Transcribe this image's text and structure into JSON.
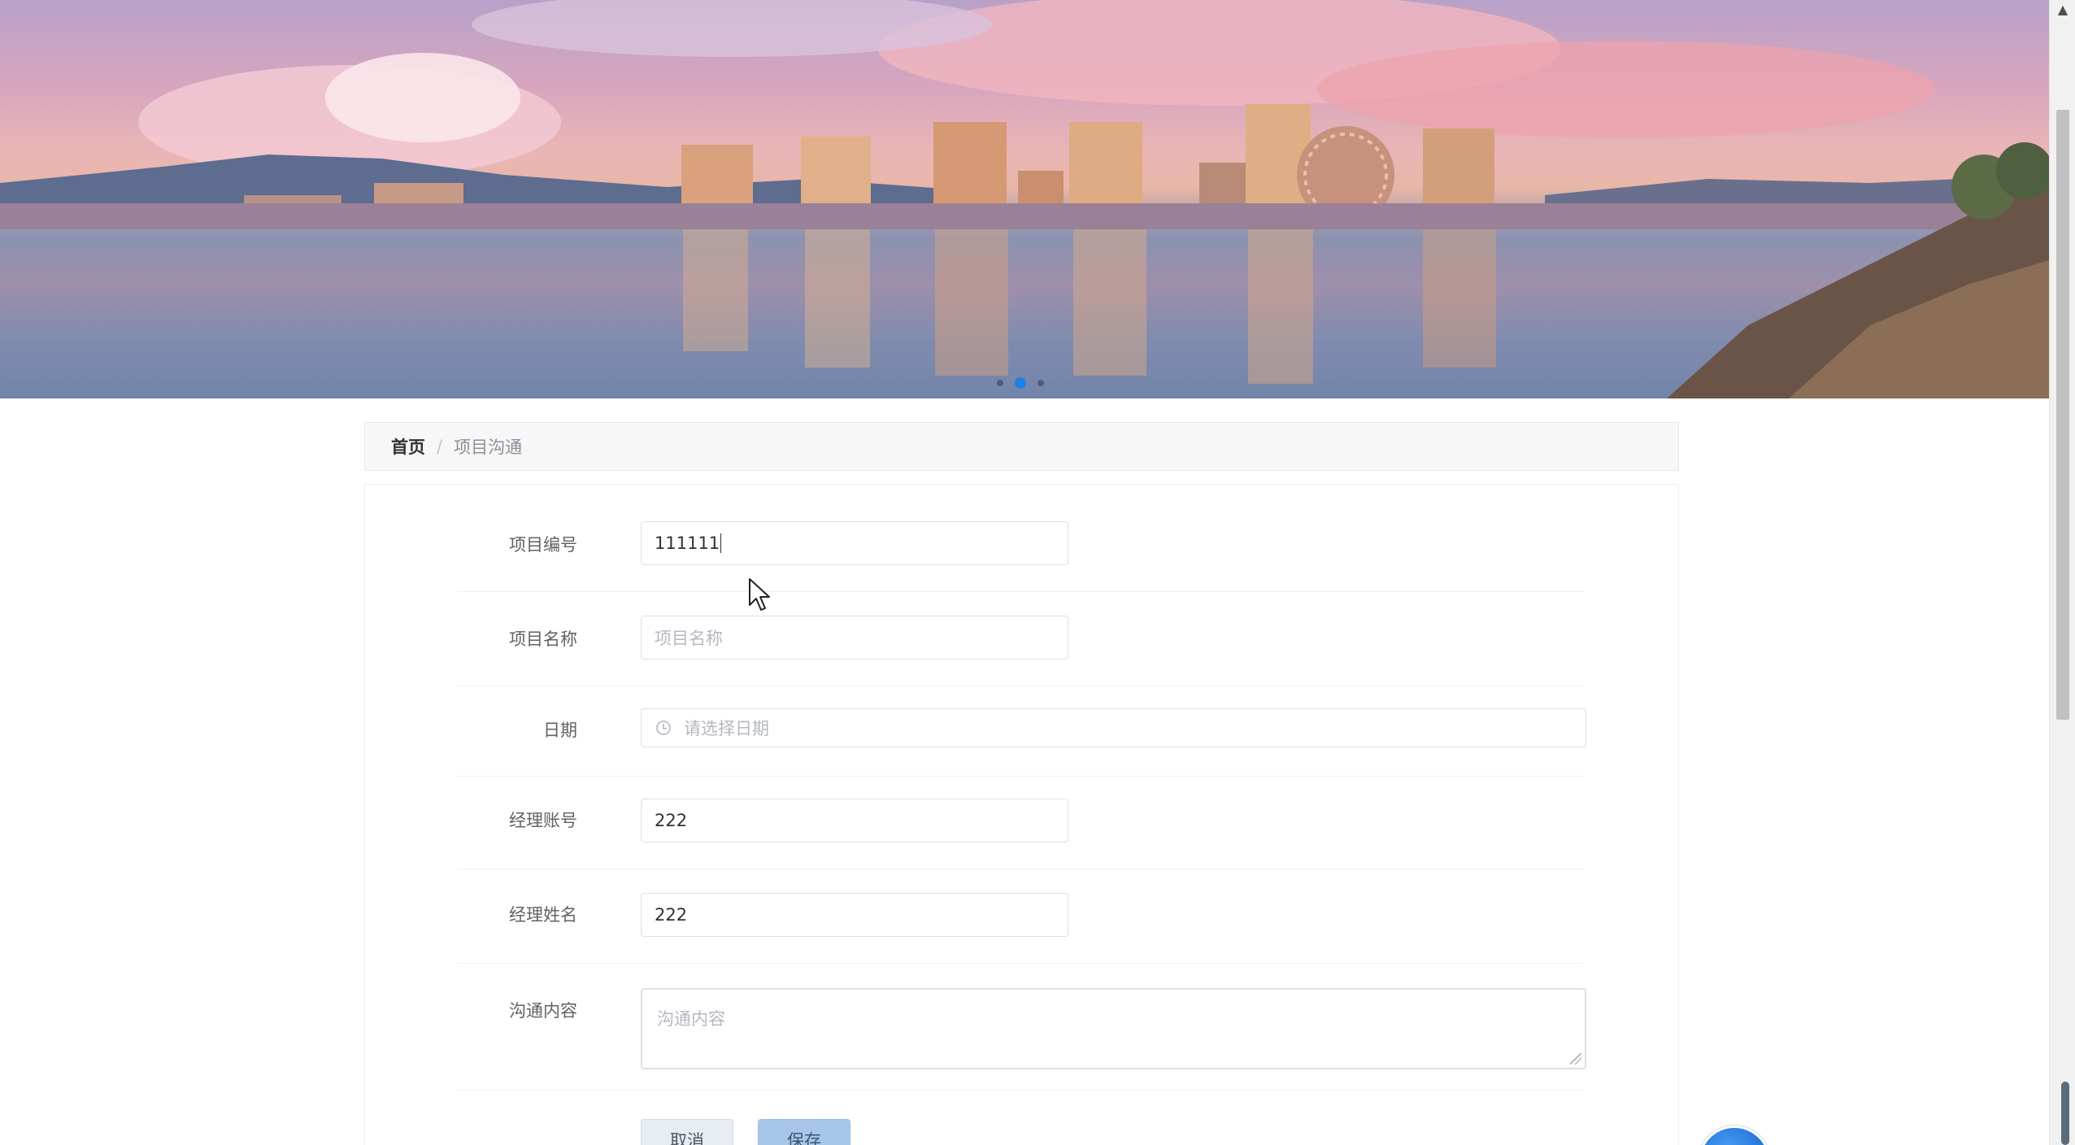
{
  "breadcrumb": {
    "home": "首页",
    "separator": "/",
    "current": "项目沟通"
  },
  "form": {
    "project_number": {
      "label": "项目编号",
      "value": "111111"
    },
    "project_name": {
      "label": "项目名称",
      "placeholder": "项目名称"
    },
    "date": {
      "label": "日期",
      "placeholder": "请选择日期",
      "icon": "clock-icon"
    },
    "manager_account": {
      "label": "经理账号",
      "value": "222"
    },
    "manager_name": {
      "label": "经理姓名",
      "value": "222"
    },
    "content": {
      "label": "沟通内容",
      "placeholder": "沟通内容"
    }
  },
  "actions": {
    "cancel_label": "取消",
    "save_label": "保存"
  },
  "carousel": {
    "slide_count": 3,
    "active_index": 1
  },
  "colors": {
    "accent": "#1e7fe6",
    "save_button": "#a8c6e8",
    "cancel_button": "#e8ecf3"
  }
}
